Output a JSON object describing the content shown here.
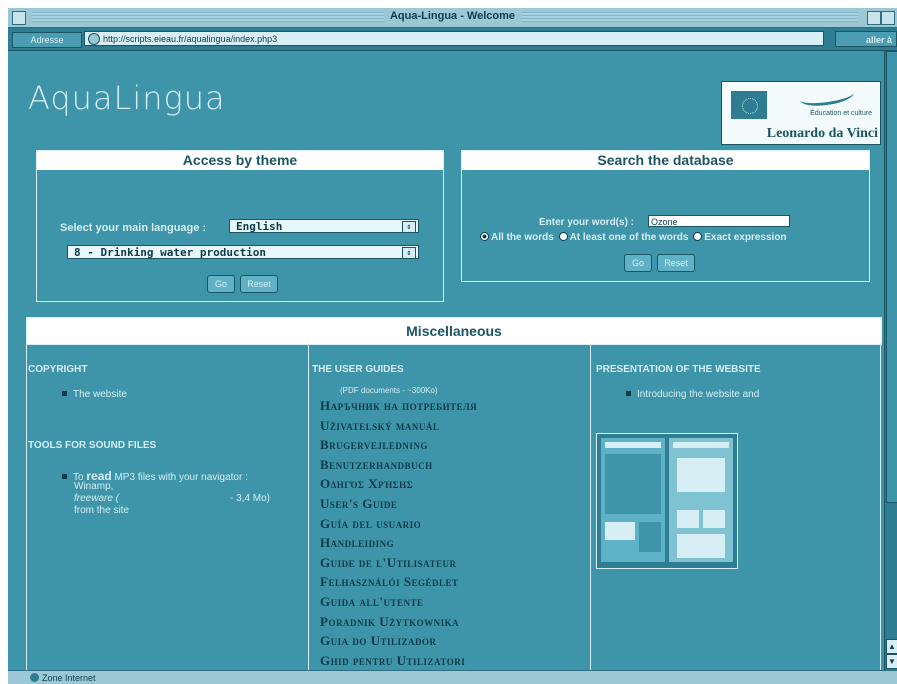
{
  "window": {
    "title": "Aqua-Lingua - Welcome"
  },
  "addressbar": {
    "label": "Adresse",
    "url": "http://scripts.eieau.fr/aqualingua/index.php3",
    "go_label": "aller à"
  },
  "header": {
    "logo_text": "AquaLingua",
    "eu_text": "Éducation et culture",
    "programme": "Leonardo da Vinci"
  },
  "theme_box": {
    "title": "Access by theme",
    "language_label": "Select your main language :",
    "language_value": "English",
    "theme_value": "8 - Drinking water production",
    "go_label": "Go",
    "reset_label": "Reset"
  },
  "search_box": {
    "title": "Search the database",
    "words_label": "Enter your word(s) :",
    "words_value": "Ozone",
    "options": [
      "All the words",
      "At least one of the words",
      "Exact expression"
    ],
    "selected_option": "All the words",
    "go_label": "Go",
    "reset_label": "Reset"
  },
  "misc": {
    "title": "Miscellaneous",
    "copyright": {
      "title": "COPYRIGHT",
      "item": "The website"
    },
    "sound_tools": {
      "title": "TOOLS FOR SOUND FILES",
      "line1_prefix": "To ",
      "line1_bold": "read",
      "line1_suffix": " MP3 files with your navigator :",
      "line2": "Winamp,",
      "line3a": "freeware (",
      "line3b": "- 3,4 Mo)",
      "line4": "from the site"
    },
    "user_guides": {
      "title": "THE USER GUIDES",
      "note": "(PDF documents - ~300Ko)",
      "guides": [
        "Наръчник на потребителя",
        "Uživatelský manuál",
        "Brugervejledning",
        "Benutzerhandbuch",
        "Οδηγός Χρήσης",
        "User's Guide",
        "Guía del usuario",
        "Handleiding",
        "Guide de l'Utilisateur",
        "Felhasználói Segédlet",
        "Guida all'utente",
        "Poradnik Użytkownika",
        "Guia do Utilizador",
        "Ghid pentru Utilizatori"
      ]
    },
    "presentation": {
      "title": "PRESENTATION OF THE WEBSITE",
      "item": "Introducing the website and"
    }
  },
  "statusbar": {
    "zone": "Zone Internet"
  },
  "colors": {
    "background": "#3e94a9",
    "header_bg": "#ffffff",
    "text_light": "#d6eef4",
    "text_dark": "#0d3b48"
  }
}
